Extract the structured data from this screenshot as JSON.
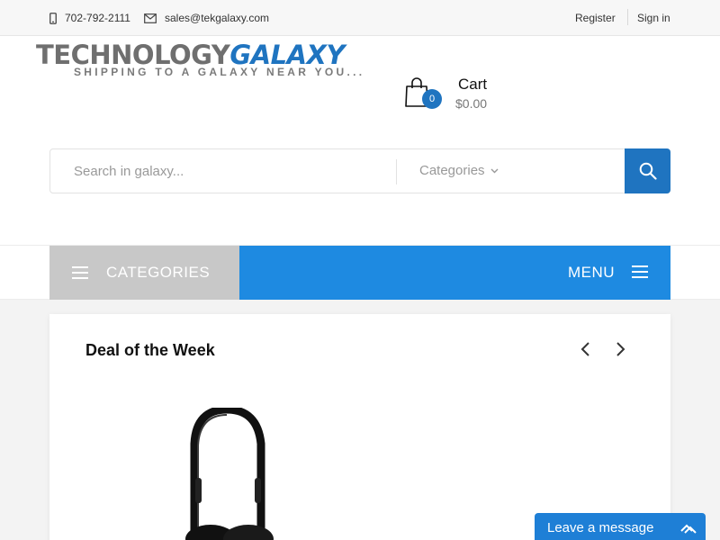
{
  "topbar": {
    "phone": "702-792-2111",
    "email": "sales@tekgalaxy.com",
    "register": "Register",
    "signin": "Sign in"
  },
  "logo": {
    "word1": "TECHNOLOGY",
    "word2": "GALAXY",
    "tagline": "SHIPPING TO A GALAXY NEAR YOU..."
  },
  "cart": {
    "count": "0",
    "title": "Cart",
    "total": "$0.00"
  },
  "search": {
    "placeholder": "Search in galaxy...",
    "category": "Categories"
  },
  "nav": {
    "categories": "CATEGORIES",
    "menu": "MENU"
  },
  "deal": {
    "title": "Deal of the Week"
  },
  "chat": {
    "label": "Leave a message"
  },
  "colors": {
    "brand": "#1f74c0",
    "menu": "#1e8ae1",
    "categories": "#c8c8c8"
  },
  "icons": [
    "phone-icon",
    "mail-icon",
    "shopping-bag-icon",
    "chevron-down-icon",
    "search-icon",
    "hamburger-icon",
    "chevron-left-icon",
    "chevron-right-icon",
    "expand-icon"
  ]
}
